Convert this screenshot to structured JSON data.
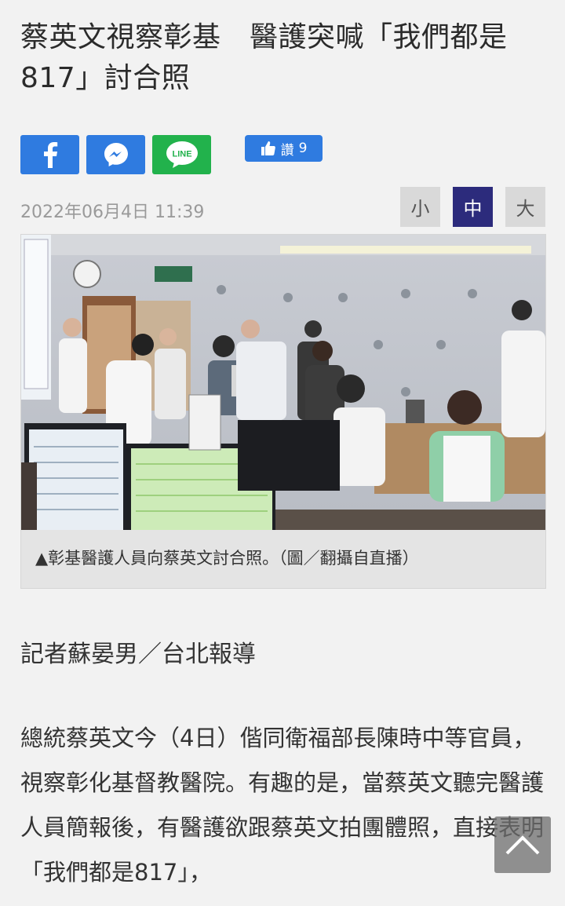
{
  "article": {
    "title": "蔡英文視察彰基　醫護突喊「我們都是817」討合照",
    "date": "2022年06月4日 11:39",
    "caption": "▲彰基醫護人員向蔡英文討合照。（圖／翻攝自直播）",
    "byline": "記者蘇晏男／台北報導",
    "body": "總統蔡英文今（4日）偕同衛福部長陳時中等官員，視察彰化基督教醫院。有趣的是，當蔡英文聽完醫護人員簡報後，有醫護欲跟蔡英文拍團體照，直接表明「我們都是817」，"
  },
  "share": {
    "facebook_icon": "facebook-icon",
    "messenger_icon": "messenger-icon",
    "line_label": "LINE",
    "like_label": "讚",
    "like_count": "9"
  },
  "font_size": {
    "small": "小",
    "medium": "中",
    "large": "大",
    "selected": "medium"
  },
  "colors": {
    "facebook": "#2f7be0",
    "line": "#22b24c",
    "font_selected": "#2c2b7c"
  }
}
